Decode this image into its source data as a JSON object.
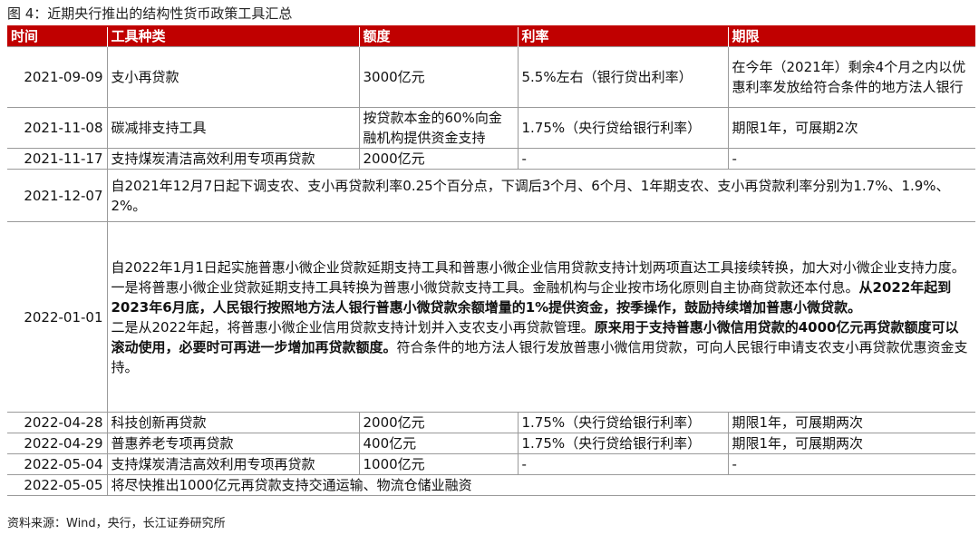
{
  "figure_title": "图 4：近期央行推出的结构性货币政策工具汇总",
  "headers": [
    "时间",
    "工具种类",
    "额度",
    "利率",
    "期限"
  ],
  "rows": [
    {
      "date": "2021-09-09",
      "tool": "支小再贷款",
      "quota": "3000亿元",
      "rate": "5.5%左右（银行贷出利率）",
      "term": "在今年（2021年）剩余4个月之内以优惠利率发放给符合条件的地方法人银行"
    },
    {
      "date": "2021-11-08",
      "tool": "碳减排支持工具",
      "quota": "按贷款本金的60%向金融机构提供资金支持",
      "rate": "1.75%（央行贷给银行利率）",
      "term": "期限1年，可展期2次"
    },
    {
      "date": "2021-11-17",
      "tool": "支持煤炭清洁高效利用专项再贷款",
      "quota": "2000亿元",
      "rate": "-",
      "term": "-"
    }
  ],
  "merged_rows": [
    {
      "date": "2021-12-07",
      "paragraphs": [
        [
          {
            "text": "自2021年12月7日起下调支农、支小再贷款利率0.25个百分点，下调后3个月、6个月、1年期支农、支小再贷款利率分别为1.7%、1.9%、2%。",
            "bold": false
          }
        ]
      ]
    },
    {
      "date": "2022-01-01",
      "paragraphs": [
        [
          {
            "text": "自2022年1月1日起实施普惠小微企业贷款延期支持工具和普惠小微企业信用贷款支持计划两项直达工具接续转换，加大对小微企业支持力度。",
            "bold": false
          }
        ],
        [
          {
            "text": "一是将普惠小微企业贷款延期支持工具转换为普惠小微贷款支持工具。金融机构与企业按市场化原则自主协商贷款还本付息。",
            "bold": false
          },
          {
            "text": "从2022年起到2023年6月底，人民银行按照地方法人银行普惠小微贷款余额增量的1%提供资金，按季操作，鼓励持续增加普惠小微贷款。",
            "bold": true
          }
        ],
        [
          {
            "text": "二是从2022年起，将普惠小微企业信用贷款支持计划并入支农支小再贷款管理。",
            "bold": false
          },
          {
            "text": "原来用于支持普惠小微信用贷款的4000亿元再贷款额度可以滚动使用，必要时可再进一步增加再贷款额度。",
            "bold": true
          },
          {
            "text": "符合条件的地方法人银行发放普惠小微信用贷款，可向人民银行申请支农支小再贷款优惠资金支持。",
            "bold": false
          }
        ]
      ]
    }
  ],
  "rows_after": [
    {
      "date": "2022-04-28",
      "tool": "科技创新再贷款",
      "quota": "2000亿元",
      "rate": "1.75%（央行贷给银行利率）",
      "term": "期限1年，可展期两次"
    },
    {
      "date": "2022-04-29",
      "tool": "普惠养老专项再贷款",
      "quota": "400亿元",
      "rate": "1.75%（央行贷给银行利率）",
      "term": "期限1年，可展期两次"
    },
    {
      "date": "2022-05-04",
      "tool": "支持煤炭清洁高效利用专项再贷款",
      "quota": "1000亿元",
      "rate": "-",
      "term": "-"
    }
  ],
  "last_row": {
    "date": "2022-05-05",
    "text": "将尽快推出1000亿元再贷款支持交通运输、物流仓储业融资"
  },
  "source": "资料来源：Wind，央行，长江证券研究所",
  "colors": {
    "header_bg": "#c00000",
    "header_text": "#ffffff",
    "grid": "#9a9a9a"
  }
}
